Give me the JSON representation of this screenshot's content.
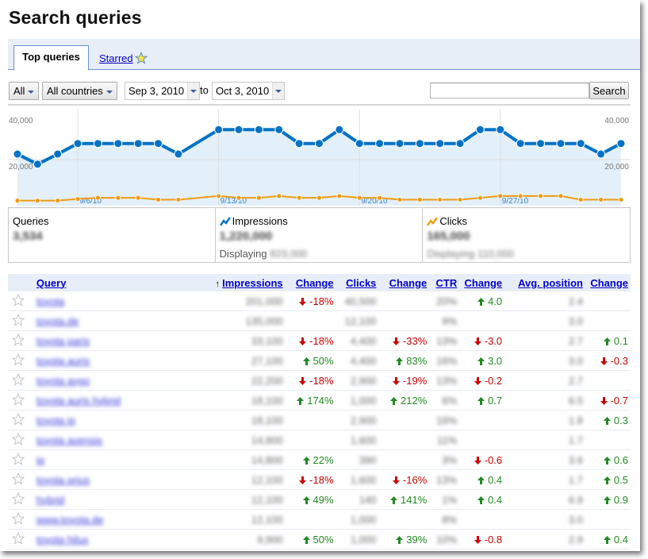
{
  "page": {
    "title": "Search queries"
  },
  "tabs": [
    {
      "label": "Top queries",
      "active": true
    },
    {
      "label": "Starred",
      "icon": "star-icon"
    }
  ],
  "controls": {
    "type_filter": "All",
    "country_filter": "All countries",
    "date_from": "Sep 3, 2010",
    "to_label": "to",
    "date_to": "Oct 3, 2010",
    "search_value": "",
    "search_placeholder": "",
    "search_button": "Search"
  },
  "colors": {
    "impressions": "#0072c6",
    "clicks": "#f39a10",
    "area_fill": "#e3f0fa",
    "up": "#208a20",
    "down": "#cc0000",
    "link": "#0000cc",
    "header_bg": "#e8eef7"
  },
  "chart_data": {
    "type": "line",
    "x": [
      "9/3/10",
      "9/4/10",
      "9/5/10",
      "9/6/10",
      "9/7/10",
      "9/8/10",
      "9/9/10",
      "9/10/10",
      "9/11/10",
      "9/12/10",
      "9/13/10",
      "9/14/10",
      "9/15/10",
      "9/16/10",
      "9/17/10",
      "9/18/10",
      "9/19/10",
      "9/20/10",
      "9/21/10",
      "9/22/10",
      "9/23/10",
      "9/24/10",
      "9/25/10",
      "9/26/10",
      "9/27/10",
      "9/28/10",
      "9/29/10",
      "9/30/10",
      "10/1/10",
      "10/2/10",
      "10/3/10"
    ],
    "x_tick_labels": [
      "9/6/10",
      "9/13/10",
      "9/20/10",
      "9/27/10"
    ],
    "x_tick_indices": [
      3,
      10,
      17,
      24
    ],
    "y_tick_labels_left": [
      "40,000",
      "20,000"
    ],
    "y_tick_labels_right": [
      "40,000",
      "20,000"
    ],
    "y_ticks": [
      40000,
      20000
    ],
    "ylim": [
      0,
      40000
    ],
    "grid": true,
    "series": [
      {
        "name": "Impressions",
        "color": "#0072c6",
        "area": true,
        "values": [
          22400,
          18000,
          22400,
          27000,
          27000,
          27000,
          27000,
          27000,
          22400,
          null,
          33000,
          33000,
          33000,
          33000,
          27000,
          27000,
          33000,
          27000,
          27000,
          27000,
          27000,
          27000,
          27000,
          33000,
          33000,
          27000,
          27000,
          27000,
          27000,
          22400,
          27000
        ]
      },
      {
        "name": "Clicks",
        "color": "#f39a10",
        "area": false,
        "values": [
          2200,
          2200,
          2200,
          2900,
          3400,
          3400,
          3400,
          2600,
          2600,
          null,
          4200,
          3400,
          3400,
          4200,
          3400,
          3400,
          4200,
          3400,
          3400,
          2600,
          2600,
          2600,
          2600,
          3400,
          4200,
          4200,
          4200,
          4200,
          2600,
          2600,
          2600
        ]
      }
    ]
  },
  "summary": [
    {
      "label": "Queries",
      "value": "3,534",
      "sub_label": "",
      "sub_value": ""
    },
    {
      "label": "Impressions",
      "icon": "impressions-trend-icon",
      "value": "1,220,000",
      "sub_label": "Displaying",
      "sub_value": "823,000"
    },
    {
      "label": "Clicks",
      "icon": "clicks-trend-icon",
      "value": "165,000",
      "sub_label": "Displaying",
      "sub_value": "110,000"
    }
  ],
  "table": {
    "sort_indicator": "↑",
    "columns": [
      "Query",
      "Impressions",
      "Change",
      "Clicks",
      "Change",
      "CTR",
      "Change",
      "Avg. position",
      "Change"
    ],
    "rows": [
      {
        "query": "toyota",
        "impressions": "201,000",
        "imp_change": "-18%",
        "imp_dir": "down",
        "clicks": "40,500",
        "clk_change": "",
        "clk_dir": "",
        "ctr": "20%",
        "ctr_change": "4.0",
        "ctr_dir": "up",
        "pos": "2.4",
        "pos_change": "",
        "pos_dir": ""
      },
      {
        "query": "toyota.de",
        "impressions": "135,000",
        "imp_change": "",
        "imp_dir": "",
        "clicks": "12,100",
        "clk_change": "",
        "clk_dir": "",
        "ctr": "9%",
        "ctr_change": "",
        "ctr_dir": "",
        "pos": "3.0",
        "pos_change": "",
        "pos_dir": ""
      },
      {
        "query": "toyota paris",
        "impressions": "33,100",
        "imp_change": "-18%",
        "imp_dir": "down",
        "clicks": "4,400",
        "clk_change": "-33%",
        "clk_dir": "down",
        "ctr": "13%",
        "ctr_change": "-3.0",
        "ctr_dir": "down",
        "pos": "2.7",
        "pos_change": "0.1",
        "pos_dir": "up"
      },
      {
        "query": "toyota auris",
        "impressions": "27,100",
        "imp_change": "50%",
        "imp_dir": "up",
        "clicks": "4,400",
        "clk_change": "83%",
        "clk_dir": "up",
        "ctr": "16%",
        "ctr_change": "3.0",
        "ctr_dir": "up",
        "pos": "3.0",
        "pos_change": "-0.3",
        "pos_dir": "down"
      },
      {
        "query": "toyota aygo",
        "impressions": "22,200",
        "imp_change": "-18%",
        "imp_dir": "down",
        "clicks": "2,900",
        "clk_change": "-19%",
        "clk_dir": "down",
        "ctr": "13%",
        "ctr_change": "-0.2",
        "ctr_dir": "down",
        "pos": "2.7",
        "pos_change": "",
        "pos_dir": ""
      },
      {
        "query": "toyota auris hybrid",
        "impressions": "18,100",
        "imp_change": "174%",
        "imp_dir": "up",
        "clicks": "1,000",
        "clk_change": "212%",
        "clk_dir": "up",
        "ctr": "6%",
        "ctr_change": "0.7",
        "ctr_dir": "up",
        "pos": "6.5",
        "pos_change": "-0.7",
        "pos_dir": "down"
      },
      {
        "query": "toyota iq",
        "impressions": "18,100",
        "imp_change": "",
        "imp_dir": "",
        "clicks": "2,900",
        "clk_change": "",
        "clk_dir": "",
        "ctr": "16%",
        "ctr_change": "",
        "ctr_dir": "",
        "pos": "1.8",
        "pos_change": "0.3",
        "pos_dir": "up"
      },
      {
        "query": "toyota avensis",
        "impressions": "14,800",
        "imp_change": "",
        "imp_dir": "",
        "clicks": "1,600",
        "clk_change": "",
        "clk_dir": "",
        "ctr": "11%",
        "ctr_change": "",
        "ctr_dir": "",
        "pos": "1.7",
        "pos_change": "",
        "pos_dir": ""
      },
      {
        "query": "iq",
        "impressions": "14,800",
        "imp_change": "22%",
        "imp_dir": "up",
        "clicks": "390",
        "clk_change": "",
        "clk_dir": "",
        "ctr": "3%",
        "ctr_change": "-0.6",
        "ctr_dir": "down",
        "pos": "3.6",
        "pos_change": "0.6",
        "pos_dir": "up"
      },
      {
        "query": "toyota prius",
        "impressions": "12,100",
        "imp_change": "-18%",
        "imp_dir": "down",
        "clicks": "1,600",
        "clk_change": "-16%",
        "clk_dir": "down",
        "ctr": "13%",
        "ctr_change": "0.4",
        "ctr_dir": "up",
        "pos": "1.7",
        "pos_change": "0.5",
        "pos_dir": "up"
      },
      {
        "query": "hybrid",
        "impressions": "12,100",
        "imp_change": "49%",
        "imp_dir": "up",
        "clicks": "140",
        "clk_change": "141%",
        "clk_dir": "up",
        "ctr": "1%",
        "ctr_change": "0.4",
        "ctr_dir": "up",
        "pos": "6.9",
        "pos_change": "0.9",
        "pos_dir": "up"
      },
      {
        "query": "www.toyota.de",
        "impressions": "12,100",
        "imp_change": "",
        "imp_dir": "",
        "clicks": "1,000",
        "clk_change": "",
        "clk_dir": "",
        "ctr": "8%",
        "ctr_change": "",
        "ctr_dir": "",
        "pos": "3.0",
        "pos_change": "",
        "pos_dir": ""
      },
      {
        "query": "toyota hilux",
        "impressions": "9,900",
        "imp_change": "50%",
        "imp_dir": "up",
        "clicks": "1,000",
        "clk_change": "39%",
        "clk_dir": "up",
        "ctr": "10%",
        "ctr_change": "-0.8",
        "ctr_dir": "down",
        "pos": "2.9",
        "pos_change": "0.4",
        "pos_dir": "up"
      }
    ]
  }
}
